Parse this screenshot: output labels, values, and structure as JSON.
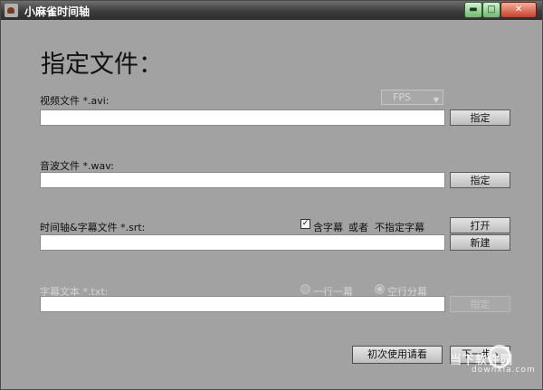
{
  "window": {
    "title": "小麻雀时间轴",
    "min_label": "▬",
    "max_label": "□",
    "close_label": "✕"
  },
  "heading": "指定文件：",
  "video": {
    "label": "视频文件 *.avi:",
    "value": "",
    "fps_selected": "FPS",
    "button": "指定"
  },
  "audio": {
    "label": "音波文件 *.wav:",
    "value": "",
    "button": "指定"
  },
  "subtitle": {
    "label": "时间轴&字幕文件 *.srt:",
    "checkbox_label": "含字幕",
    "checkbox_checked": true,
    "or_text": "或者",
    "unspecified_label": "不指定字幕",
    "value": "",
    "open_button": "打开",
    "new_button": "新建"
  },
  "text": {
    "label": "字幕文本 *.txt:",
    "radio_one": "一行一幕",
    "radio_two": "空行分幕",
    "radio_selected": "空行分幕",
    "value": "",
    "button": "指定"
  },
  "footer": {
    "first_use_button": "初次使用请看",
    "next_button": "下一步 ›"
  },
  "watermark": {
    "site": "当下软件园",
    "url": "downxia.com"
  }
}
